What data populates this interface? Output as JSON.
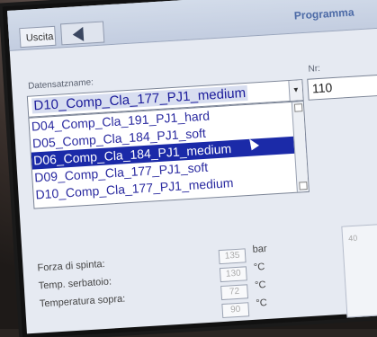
{
  "header": {
    "exit_label": "Uscita",
    "title": "Programma"
  },
  "form": {
    "name_label": "Datensatzname:",
    "nr_label": "Nr:",
    "selected_value": "D10_Comp_Cla_177_PJ1_medium",
    "nr_value": "110"
  },
  "dropdown_items": [
    "D04_Comp_Cla_191_PJ1_hard",
    "D05_Comp_Cla_184_PJ1_soft",
    "D06_Comp_Cla_184_PJ1_medium",
    "D09_Comp_Cla_177_PJ1_soft",
    "D10_Comp_Cla_177_PJ1_medium"
  ],
  "params": [
    {
      "label": "Forza di spinta:",
      "value": "135",
      "unit": "bar"
    },
    {
      "label": "Temp. serbatoio:",
      "value": "130",
      "unit": "°C"
    },
    {
      "label": "Temperatura sopra:",
      "value": "72",
      "unit": "°C"
    },
    {
      "label": "",
      "value": "90",
      "unit": "°C"
    }
  ],
  "gauge": {
    "tick": "40"
  }
}
